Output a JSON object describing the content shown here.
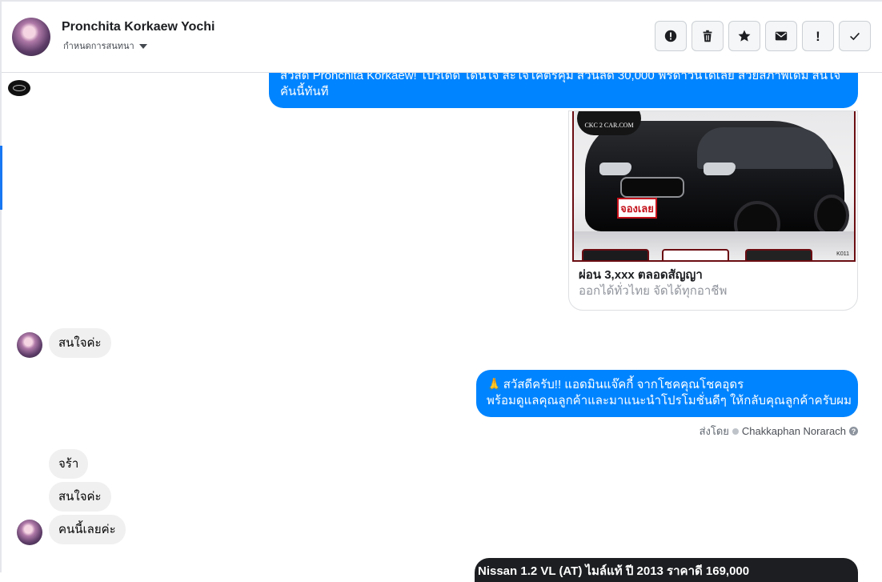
{
  "header": {
    "contact_name": "Pronchita Korkaew Yochi",
    "assign_label": "กำหนดการสนทนา",
    "actions": [
      {
        "name": "spam",
        "icon": "alert-circle-icon"
      },
      {
        "name": "delete",
        "icon": "trash-icon"
      },
      {
        "name": "star",
        "icon": "star-icon"
      },
      {
        "name": "unread",
        "icon": "envelope-icon"
      },
      {
        "name": "follow-up",
        "icon": "exclamation-icon",
        "label": "!"
      },
      {
        "name": "done",
        "icon": "check-icon"
      }
    ]
  },
  "messages": {
    "outgoing_1": {
      "line1": "สวัสดี Pronchita Korkaew! โปรเด็ด โดนใจ สะใจโคตรคุ้ม ส่วนลด 30,000 ฟรีดาวน์ได้เลย สวยสภาพเดิม สนใจ",
      "line2": "คันนี้ทันที"
    },
    "card": {
      "brand_badge": "CKC 2 CAR.COM",
      "book_tag": "จองเลย",
      "code_tag": "K011",
      "title": "ผ่อน 3,xxx ตลอดสัญญา",
      "subtitle": "ออกได้ทั่วไทย จัดได้ทุกอาชีพ"
    },
    "incoming_1": "สนใจค่ะ",
    "outgoing_2": {
      "emoji": "🙏",
      "line1": "สวัสดีครับ!! แอดมินแจ๊คกี้ จากโชคคุณโชคอุดร",
      "line2": "พร้อมดูแลคุณลูกค้าและมาแนะนำโปรโมชั่นดีๆ ให้กลับคุณลูกค้าครับผม"
    },
    "sent_by_label": "ส่งโดย",
    "sent_by_name": "Chakkaphan Norarach",
    "sent_by_help": "?",
    "incoming_2": "จร้า",
    "incoming_3": "สนใจค่ะ",
    "incoming_4": "คนนี้เลยค่ะ",
    "outgoing_3_partial": "Nissan 1.2 VL (AT) ไมล์แท้ ปี 2013 ราคาดี 169,000"
  },
  "colors": {
    "messenger_blue": "#0084ff",
    "incoming_gray": "#f0f0f0",
    "active_indicator": "#1877f2"
  }
}
